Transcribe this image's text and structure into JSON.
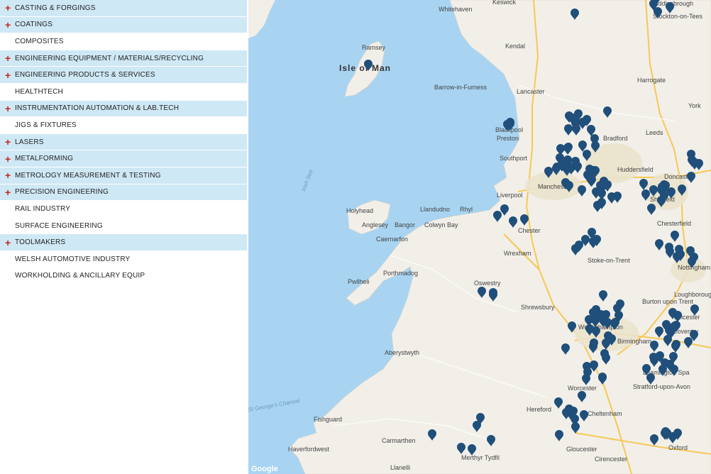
{
  "sidebar": {
    "categories": [
      {
        "label": "CASTING & FORGINGS",
        "expandable": true
      },
      {
        "label": "COATINGS",
        "expandable": true
      },
      {
        "label": "COMPOSITES",
        "expandable": false
      },
      {
        "label": "ENGINEERING EQUIPMENT / MATERIALS/RECYCLING",
        "expandable": true
      },
      {
        "label": "ENGINEERING PRODUCTS & SERVICES",
        "expandable": true
      },
      {
        "label": "HEALTHTECH",
        "expandable": false
      },
      {
        "label": "INSTRUMENTATION AUTOMATION & LAB.TECH",
        "expandable": true
      },
      {
        "label": "JIGS & FIXTURES",
        "expandable": false
      },
      {
        "label": "LASERS",
        "expandable": true
      },
      {
        "label": "METALFORMING",
        "expandable": true
      },
      {
        "label": "METROLOGY MEASUREMENT & TESTING",
        "expandable": true
      },
      {
        "label": "PRECISION ENGINEERING",
        "expandable": true
      },
      {
        "label": "RAIL INDUSTRY",
        "expandable": false
      },
      {
        "label": "SURFACE ENGINEERING",
        "expandable": false
      },
      {
        "label": "TOOLMAKERS",
        "expandable": true
      },
      {
        "label": "WELSH AUTOMOTIVE INDUSTRY",
        "expandable": false
      },
      {
        "label": "WORKHOLDING & ANCILLARY EQUIP",
        "expandable": false
      }
    ],
    "plus_glyph": "+"
  },
  "map": {
    "places": [
      "Isle of Man",
      "Ramsey",
      "Whitehaven",
      "Keswick",
      "Kendal",
      "Barrow-in-Furness",
      "Lancaster",
      "Middlesbrough",
      "Stockton-on-Tees",
      "Harrogate",
      "York",
      "Blackpool",
      "Preston",
      "Southport",
      "Bradford",
      "Leeds",
      "Huddersfield",
      "Manchester",
      "Liverpool",
      "Doncaster",
      "Sheffield",
      "Chesterfield",
      "Holyhead",
      "Anglesey",
      "Bangor",
      "Llandudno",
      "Rhyl",
      "Colwyn Bay",
      "Caernarfon",
      "Chester",
      "Wrexham",
      "Stoke-on-Trent",
      "Nottingham",
      "Porthmadog",
      "Pwllheli",
      "Oswestry",
      "Shrewsbury",
      "Burton upon Trent",
      "Loughborough",
      "Leicester",
      "Wolverhampton",
      "Birmingham",
      "Coventry",
      "Leamington Spa",
      "Stratford-upon-Avon",
      "Aberystwyth",
      "Worcester",
      "Hereford",
      "Cheltenham",
      "Gloucester",
      "Cirencester",
      "Oxford",
      "Fishguard",
      "Carmarthen",
      "Haverfordwest",
      "Llanelli",
      "Merthyr Tydfil",
      "Irish Sea",
      "St George's Channel",
      "Google"
    ],
    "pin_color": "#1f4f7a",
    "land_color": "#f2efe9",
    "water_color": "#a8d4f2",
    "marker_count": 160
  }
}
